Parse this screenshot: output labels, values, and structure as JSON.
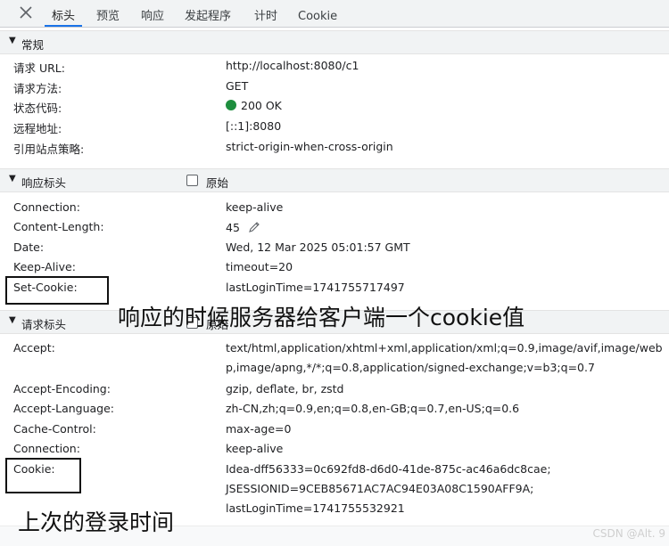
{
  "tabs": [
    {
      "label": "标头",
      "active": true
    },
    {
      "label": "预览",
      "active": false
    },
    {
      "label": "响应",
      "active": false
    },
    {
      "label": "发起程序",
      "active": false
    },
    {
      "label": "计时",
      "active": false
    },
    {
      "label": "Cookie",
      "active": false
    }
  ],
  "general": {
    "title": "常规",
    "rows": [
      {
        "key": "请求 URL:",
        "value": "http://localhost:8080/c1"
      },
      {
        "key": "请求方法:",
        "value": "GET"
      },
      {
        "key": "状态代码:",
        "value": "200 OK",
        "status_color": "#1e8e3e"
      },
      {
        "key": "远程地址:",
        "value": "[::1]:8080"
      },
      {
        "key": "引用站点策略:",
        "value": "strict-origin-when-cross-origin"
      }
    ]
  },
  "response_headers": {
    "title": "响应标头",
    "raw_label": "原始",
    "raw_checked": false,
    "rows": [
      {
        "key": "Connection:",
        "value": "keep-alive"
      },
      {
        "key": "Content-Length:",
        "value": "45"
      },
      {
        "key": "Date:",
        "value": "Wed, 12 Mar 2025 05:01:57 GMT"
      },
      {
        "key": "Keep-Alive:",
        "value": "timeout=20"
      },
      {
        "key": "Set-Cookie:",
        "value": "lastLoginTime=1741755717497"
      }
    ]
  },
  "request_headers": {
    "title": "请求标头",
    "raw_label": "原始",
    "rows": [
      {
        "key": "Accept:",
        "value": "text/html,application/xhtml+xml,application/xml;q=0.9,image/avif,image/webp,image/apng,*/*;q=0.8,application/signed-exchange;v=b3;q=0.7"
      },
      {
        "key": "Accept-Encoding:",
        "value": "gzip, deflate, br, zstd"
      },
      {
        "key": "Accept-Language:",
        "value": "zh-CN,zh;q=0.9,en;q=0.8,en-GB;q=0.7,en-US;q=0.6"
      },
      {
        "key": "Cache-Control:",
        "value": "max-age=0"
      },
      {
        "key": "Connection:",
        "value": "keep-alive"
      },
      {
        "key": "Cookie:",
        "value_lines": [
          "Idea-dff56333=0c692fd8-d6d0-41de-875c-ac46a6dc8cae;",
          "JSESSIONID=9CEB85671AC7AC94E03A08C1590AFF9A;",
          "lastLoginTime=1741755532921"
        ]
      }
    ]
  },
  "annotations": {
    "response_note": "响应的时候服务器给客户端一个cookie值",
    "request_note": "上次的登录时间"
  },
  "watermark": "CSDN @Alt. 9"
}
